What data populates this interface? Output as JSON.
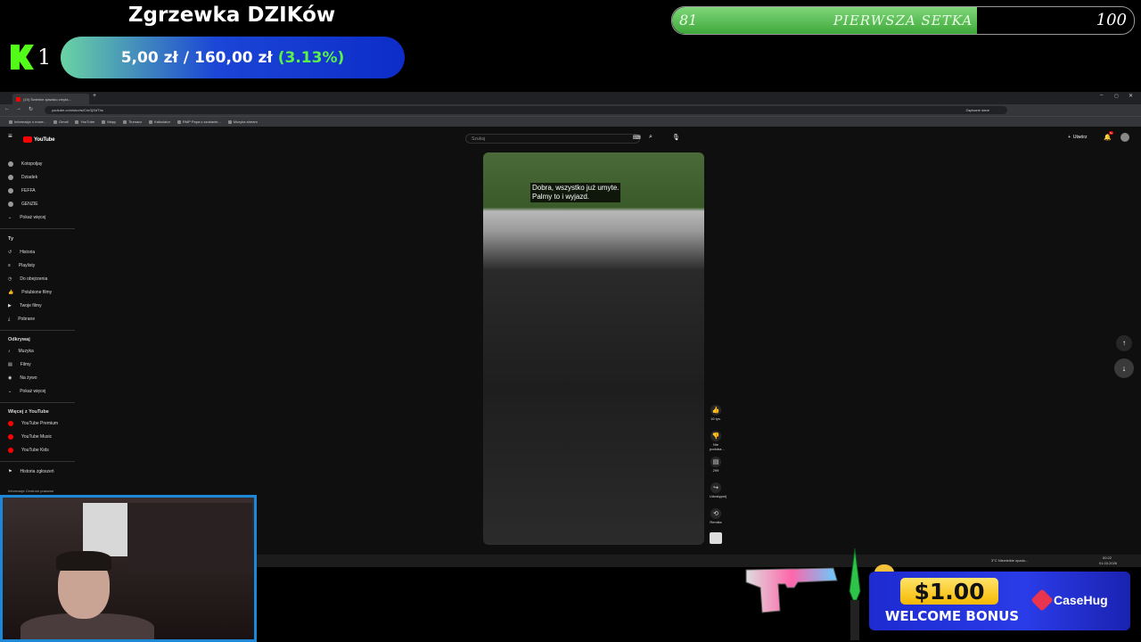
{
  "overlay": {
    "goal_title": "Zgrzewka DZIKów",
    "kick_count": "1",
    "goal_current": "5,00 zł",
    "goal_separator": "/",
    "goal_target": "160,00 zł",
    "goal_percent": "(3.13%)",
    "goal_fraction": 0.0313,
    "sub_current": "81",
    "sub_label": "PIERWSZA SETKA",
    "sub_max": "100",
    "sub_fraction": 0.81
  },
  "browser": {
    "tab_title": "(19) Świetnie zjawsko zmyta...",
    "url": "youtube.com/shorts/CmGjSdThs",
    "profile_label": "Zapisane dane",
    "bookmarks": [
      "Informacje o nowe...",
      "Gmail",
      "YouTube",
      "Mapy",
      "Tłumacz",
      "Kalkulator",
      "RMP Papa o szukanie...",
      "Muzyka stream"
    ]
  },
  "youtube": {
    "logo_text": "YouTube",
    "search_placeholder": "Szukaj",
    "create_label": "Utwórz",
    "notif_count": "9+",
    "sidebar": {
      "subs": [
        "Kotopoljay",
        "Dziadek",
        "FEFFA",
        "GENZIE",
        "Pokaż więcej"
      ],
      "you_header": "Ty",
      "you_items": [
        "Historia",
        "Playlisty",
        "Do obejrzenia",
        "Polubione filmy",
        "Twoje filmy",
        "Pobrane"
      ],
      "explore_header": "Odkrywaj",
      "explore_items": [
        "Muzyka",
        "Filmy",
        "Na żywo",
        "Pokaż więcej"
      ],
      "more_header": "Więcej z YouTube",
      "more_items": [
        "YouTube Premium",
        "YouTube Music",
        "YouTube Kids"
      ],
      "report_label": "Historia zgłoszeń",
      "footer": "Informacje  Centrum prasowe"
    },
    "caption_line1": "Dobra, wszystko już umyte.",
    "caption_line2": "Palmy to i wyjazd.",
    "actions": {
      "like": "16 tys.",
      "dislike": "Nie podoba...",
      "comments": "299",
      "share": "Udostępnij",
      "remix": "Remiks"
    }
  },
  "taskbar": {
    "weather": "3°C  Niewielkie opadu...",
    "time": "00:22",
    "date": "01.03.2026"
  },
  "ad": {
    "amount": "$1.00",
    "bonus": "WELCOME BONUS",
    "brand": "CaseHug"
  }
}
